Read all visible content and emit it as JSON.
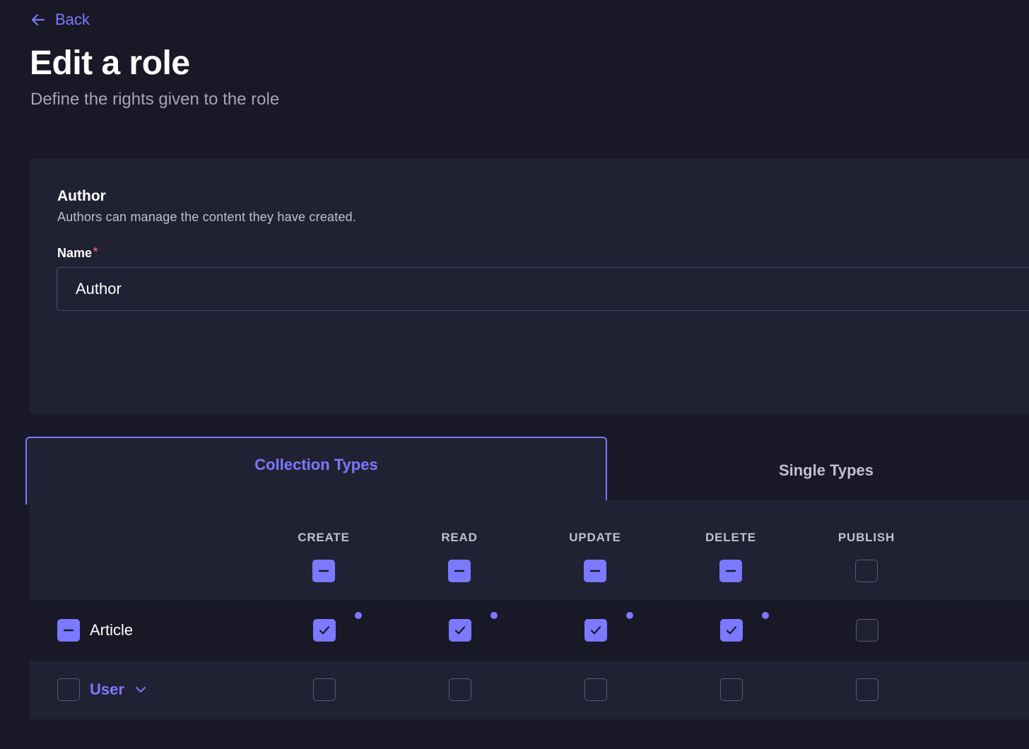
{
  "back": {
    "label": "Back"
  },
  "header": {
    "title": "Edit a role",
    "subtitle": "Define the rights given to the role"
  },
  "role": {
    "name": "Author",
    "description": "Authors can manage the content they have created.",
    "name_field": {
      "label": "Name",
      "required_marker": "*",
      "value": "Author"
    }
  },
  "tabs": [
    {
      "label": "Collection Types",
      "active": true
    },
    {
      "label": "Single Types",
      "active": false
    }
  ],
  "permissions": {
    "columns": [
      "CREATE",
      "READ",
      "UPDATE",
      "DELETE",
      "PUBLISH"
    ],
    "header_state": [
      "indeterminate",
      "indeterminate",
      "indeterminate",
      "indeterminate",
      "unchecked"
    ],
    "rows": [
      {
        "label": "Article",
        "row_state": "indeterminate",
        "cells": [
          "checked",
          "checked",
          "checked",
          "checked",
          "unchecked"
        ],
        "has_conditions": [
          true,
          true,
          true,
          true,
          false
        ],
        "expandable": false
      },
      {
        "label": "User",
        "row_state": "unchecked",
        "cells": [
          "unchecked",
          "unchecked",
          "unchecked",
          "unchecked",
          "unchecked"
        ],
        "has_conditions": [
          false,
          false,
          false,
          false,
          false
        ],
        "expandable": true
      }
    ]
  },
  "colors": {
    "background": "#181826",
    "surface": "#212134",
    "accent": "#7b79ff",
    "required": "#ee5e52",
    "muted_text": "#a5a5ba"
  }
}
